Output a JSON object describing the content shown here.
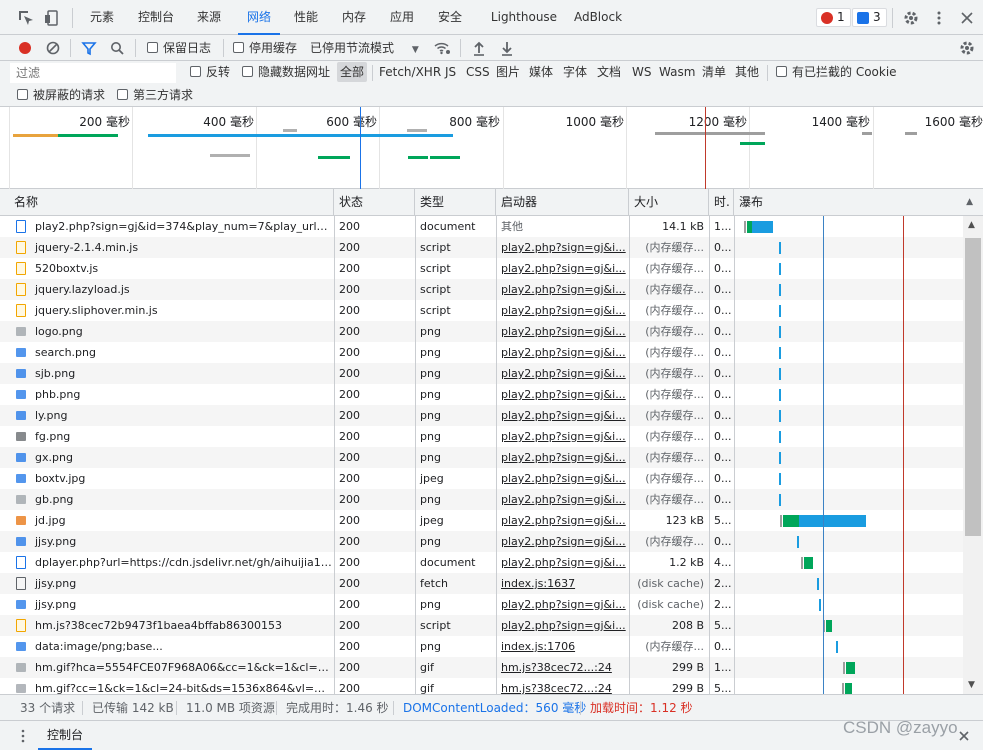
{
  "tabs": {
    "items": [
      "元素",
      "控制台",
      "来源",
      "网络",
      "性能",
      "内存",
      "应用",
      "安全",
      "Lighthouse",
      "AdBlock"
    ],
    "active_index": 3,
    "error_count": "1",
    "message_count": "3"
  },
  "toolbar": {
    "preserve_log": "保留日志",
    "disable_cache": "停用缓存",
    "throttle": "已停用节流模式"
  },
  "filter": {
    "placeholder": "过滤",
    "invert": "反转",
    "hide_data_urls": "隐藏数据网址",
    "types": [
      "全部",
      "Fetch/XHR",
      "JS",
      "CSS",
      "图片",
      "媒体",
      "字体",
      "文档",
      "WS",
      "Wasm",
      "清单",
      "其他"
    ],
    "blocked_cookies": "有已拦截的 Cookie",
    "blocked_requests": "被屏蔽的请求",
    "third_party": "第三方请求"
  },
  "overview": {
    "ticks": [
      "200 毫秒",
      "400 毫秒",
      "600 毫秒",
      "800 毫秒",
      "1000 毫秒",
      "1200 毫秒",
      "1400 毫秒",
      "1600 毫秒"
    ]
  },
  "columns": {
    "name": "名称",
    "status": "状态",
    "type": "类型",
    "initiator": "启动器",
    "size": "大小",
    "time": "时.",
    "waterfall": "瀑布"
  },
  "rows": [
    {
      "name": "play2.php?sign=gj&id=374&play_num=7&play_url=a...",
      "status": "200",
      "type": "document",
      "initiator": "其他",
      "size": "14.1 kB",
      "time": "1...",
      "icon": "document-icon",
      "icon_color": "#1a73e8",
      "wf_start_ms": 7,
      "wf_end_ms": 38
    },
    {
      "name": "jquery-2.1.4.min.js",
      "status": "200",
      "type": "script",
      "initiator": "play2.php?sign=gj&i...",
      "size": "(内存缓存...",
      "time": "0...",
      "icon": "script-icon",
      "icon_color": "#f2a600",
      "wf_start_ms": 44,
      "wf_end_ms": 45
    },
    {
      "name": "520boxtv.js",
      "status": "200",
      "type": "script",
      "initiator": "play2.php?sign=gj&i...",
      "size": "(内存缓存...",
      "time": "0...",
      "icon": "script-icon",
      "icon_color": "#f2a600",
      "wf_start_ms": 44,
      "wf_end_ms": 45
    },
    {
      "name": "jquery.lazyload.js",
      "status": "200",
      "type": "script",
      "initiator": "play2.php?sign=gj&i...",
      "size": "(内存缓存...",
      "time": "0...",
      "icon": "script-icon",
      "icon_color": "#f2a600",
      "wf_start_ms": 44,
      "wf_end_ms": 45
    },
    {
      "name": "jquery.sliphover.min.js",
      "status": "200",
      "type": "script",
      "initiator": "play2.php?sign=gj&i...",
      "size": "(内存缓存...",
      "time": "0...",
      "icon": "script-icon",
      "icon_color": "#f2a600",
      "wf_start_ms": 44,
      "wf_end_ms": 45
    },
    {
      "name": "logo.png",
      "status": "200",
      "type": "png",
      "initiator": "play2.php?sign=gj&i...",
      "size": "(内存缓存...",
      "time": "0...",
      "icon": "image-icon",
      "icon_color": "#9aa0a6",
      "wf_start_ms": 44,
      "wf_end_ms": 45
    },
    {
      "name": "search.png",
      "status": "200",
      "type": "png",
      "initiator": "play2.php?sign=gj&i...",
      "size": "(内存缓存...",
      "time": "0...",
      "icon": "image-icon",
      "icon_color": "#1a73e8",
      "wf_start_ms": 44,
      "wf_end_ms": 45
    },
    {
      "name": "sjb.png",
      "status": "200",
      "type": "png",
      "initiator": "play2.php?sign=gj&i...",
      "size": "(内存缓存...",
      "time": "0...",
      "icon": "image-icon",
      "icon_color": "#1a73e8",
      "wf_start_ms": 44,
      "wf_end_ms": 45
    },
    {
      "name": "phb.png",
      "status": "200",
      "type": "png",
      "initiator": "play2.php?sign=gj&i...",
      "size": "(内存缓存...",
      "time": "0...",
      "icon": "image-icon",
      "icon_color": "#1a73e8",
      "wf_start_ms": 44,
      "wf_end_ms": 45
    },
    {
      "name": "ly.png",
      "status": "200",
      "type": "png",
      "initiator": "play2.php?sign=gj&i...",
      "size": "(内存缓存...",
      "time": "0...",
      "icon": "image-icon",
      "icon_color": "#1a73e8",
      "wf_start_ms": 44,
      "wf_end_ms": 45
    },
    {
      "name": "fg.png",
      "status": "200",
      "type": "png",
      "initiator": "play2.php?sign=gj&i...",
      "size": "(内存缓存...",
      "time": "0...",
      "icon": "image-icon",
      "icon_color": "#5f6368",
      "wf_start_ms": 44,
      "wf_end_ms": 45
    },
    {
      "name": "gx.png",
      "status": "200",
      "type": "png",
      "initiator": "play2.php?sign=gj&i...",
      "size": "(内存缓存...",
      "time": "0...",
      "icon": "image-icon",
      "icon_color": "#1a73e8",
      "wf_start_ms": 44,
      "wf_end_ms": 45
    },
    {
      "name": "boxtv.jpg",
      "status": "200",
      "type": "jpeg",
      "initiator": "play2.php?sign=gj&i...",
      "size": "(内存缓存...",
      "time": "0...",
      "icon": "image-icon",
      "icon_color": "#1a73e8",
      "wf_start_ms": 44,
      "wf_end_ms": 45
    },
    {
      "name": "gb.png",
      "status": "200",
      "type": "png",
      "initiator": "play2.php?sign=gj&i...",
      "size": "(内存缓存...",
      "time": "0...",
      "icon": "image-icon",
      "icon_color": "#9aa0a6",
      "wf_start_ms": 44,
      "wf_end_ms": 45
    },
    {
      "name": "jd.jpg",
      "status": "200",
      "type": "jpeg",
      "initiator": "play2.php?sign=gj&i...",
      "size": "123 kB",
      "time": "5...",
      "icon": "image-icon",
      "icon_color": "#e8710a",
      "wf_start_ms": 45,
      "wf_end_ms": 135
    },
    {
      "name": "jjsy.png",
      "status": "200",
      "type": "png",
      "initiator": "play2.php?sign=gj&i...",
      "size": "(内存缓存...",
      "time": "0...",
      "icon": "image-icon",
      "icon_color": "#1a73e8",
      "wf_start_ms": 63,
      "wf_end_ms": 64
    },
    {
      "name": "dplayer.php?url=https://cdn.jsdelivr.net/gh/aihuijia13...",
      "status": "200",
      "type": "document",
      "initiator": "play2.php?sign=gj&i...",
      "size": "1.2 kB",
      "time": "4...",
      "icon": "document-icon",
      "icon_color": "#1a73e8",
      "wf_start_ms": 67,
      "wf_end_ms": 79
    },
    {
      "name": "jjsy.png",
      "status": "200",
      "type": "fetch",
      "initiator": "index.js:1637",
      "size": "(disk cache)",
      "time": "2...",
      "icon": "fetch-icon",
      "icon_color": "#5f6368",
      "wf_start_ms": 84,
      "wf_end_ms": 86
    },
    {
      "name": "jjsy.png",
      "status": "200",
      "type": "png",
      "initiator": "play2.php?sign=gj&i...",
      "size": "(disk cache)",
      "time": "2...",
      "icon": "image-icon",
      "icon_color": "#1a73e8",
      "wf_start_ms": 86,
      "wf_end_ms": 88
    },
    {
      "name": "hm.js?38cec72b9473f1baea4bffab86300153",
      "status": "200",
      "type": "script",
      "initiator": "play2.php?sign=gj&i...",
      "size": "208 B",
      "time": "5...",
      "icon": "script-icon",
      "icon_color": "#f2a600",
      "wf_start_ms": 90,
      "wf_end_ms": 99
    },
    {
      "name": "data:image/png;base...",
      "status": "200",
      "type": "png",
      "initiator": "index.js:1706",
      "size": "(内存缓存...",
      "time": "0...",
      "icon": "image-icon",
      "icon_color": "#1a73e8",
      "wf_start_ms": 103,
      "wf_end_ms": 104
    },
    {
      "name": "hm.gif?hca=5554FCE07F968A06&cc=1&ck=1&cl=24-...",
      "status": "200",
      "type": "gif",
      "initiator": "hm.js?38cec72...:24",
      "size": "299 B",
      "time": "1...",
      "icon": "image-icon",
      "icon_color": "#9aa0a6",
      "wf_start_ms": 111,
      "wf_end_ms": 123
    },
    {
      "name": "hm.gif?cc=1&ck=1&cl=24-bit&ds=1536x864&vl=722...",
      "status": "200",
      "type": "gif",
      "initiator": "hm.js?38cec72...:24",
      "size": "299 B",
      "time": "5...",
      "icon": "image-icon",
      "icon_color": "#9aa0a6",
      "wf_start_ms": 110,
      "wf_end_ms": 120
    }
  ],
  "waterfall": {
    "domcontentloaded_ms": 90,
    "load_ms": 173,
    "scale_max_ms": 233,
    "colors": {
      "waiting": "#00a65a",
      "download": "#1a9ce0",
      "queued": "#9e9e9e",
      "dcl": "#3b82c4",
      "load": "#c0392b"
    }
  },
  "status_bar": {
    "requests": "33 个请求",
    "transferred": "已传输 142 kB",
    "resources": "11.0 MB 项资源",
    "finish": "完成用时：1.46 秒",
    "dcl": "DOMContentLoaded：560 毫秒",
    "load": "加载时间：1.12 秒",
    "dcl_color": "#1a73e8",
    "load_color": "#d93025"
  },
  "drawer": {
    "tab": "控制台"
  },
  "watermark": "CSDN @zayyo"
}
